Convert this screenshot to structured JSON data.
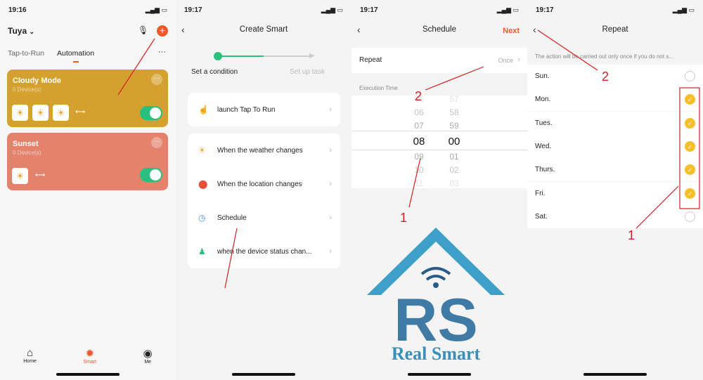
{
  "screen1": {
    "time": "19:16",
    "title": "Tuya",
    "tabs": [
      "Tap-to-Run",
      "Automation"
    ],
    "active_tab": "Automation",
    "cards": [
      {
        "name": "Cloudy Mode",
        "devices": "0 Device(s)",
        "color": "#d4a12e",
        "enabled": true,
        "conditions": 3
      },
      {
        "name": "Sunset",
        "devices": "0 Device(s)",
        "color": "#e4826c",
        "enabled": true,
        "conditions": 1
      }
    ],
    "nav": [
      "Home",
      "Smart",
      "Me"
    ],
    "active_nav": "Smart"
  },
  "screen2": {
    "time": "19:17",
    "title": "Create Smart",
    "steps": [
      "Set a condition",
      "Set up task"
    ],
    "items": [
      {
        "label": "launch Tap To Run",
        "icon": "hand-icon"
      },
      {
        "label": "When the weather changes",
        "icon": "sun-icon"
      },
      {
        "label": "When the location changes",
        "icon": "location-icon"
      },
      {
        "label": "Schedule",
        "icon": "clock-icon"
      },
      {
        "label": "when the device status chan...",
        "icon": "device-icon"
      }
    ]
  },
  "screen3": {
    "time": "19:17",
    "title": "Schedule",
    "next": "Next",
    "repeat_label": "Repeat",
    "repeat_value": "Once",
    "section": "Execution Time",
    "hours": [
      "05",
      "06",
      "07",
      "08",
      "09",
      "10",
      "11"
    ],
    "minutes": [
      "57",
      "58",
      "59",
      "00",
      "01",
      "02",
      "03"
    ],
    "selected_hour": "08",
    "selected_minute": "00"
  },
  "screen4": {
    "time": "19:17",
    "title": "Repeat",
    "note": "The action will be carried out only once if you do not s...",
    "days": [
      {
        "label": "Sun.",
        "checked": false
      },
      {
        "label": "Mon.",
        "checked": true
      },
      {
        "label": "Tues.",
        "checked": true
      },
      {
        "label": "Wed.",
        "checked": true
      },
      {
        "label": "Thurs.",
        "checked": true
      },
      {
        "label": "Fri.",
        "checked": true
      },
      {
        "label": "Sat.",
        "checked": false
      }
    ]
  },
  "annotations": {
    "one": "1",
    "two": "2"
  },
  "logo": {
    "text": "Real Smart",
    "letters": "RS"
  },
  "colors": {
    "accent": "#f0582c",
    "toggle": "#2bbf7e",
    "check": "#f7be27",
    "annotation": "#d21f1f"
  }
}
